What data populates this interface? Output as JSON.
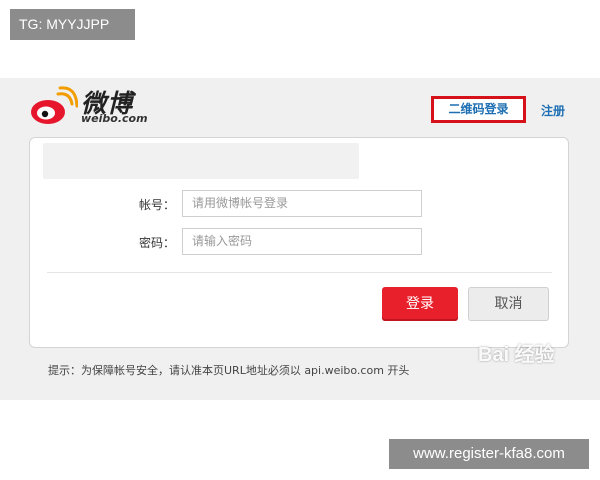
{
  "watermarks": {
    "top_left": "TG: MYYJJPP",
    "bottom_right": "www.register-kfa8.com",
    "baidu": "Bai 经验"
  },
  "header": {
    "logo_cn": "微博",
    "logo_en": "weibo.com",
    "qr_login": "二维码登录",
    "register": "注册"
  },
  "form": {
    "account_label": "帐号：",
    "account_placeholder": "请用微博帐号登录",
    "password_label": "密码：",
    "password_placeholder": "请输入密码",
    "login_button": "登录",
    "cancel_button": "取消"
  },
  "footer": {
    "tip": "提示：为保障帐号安全，请认准本页URL地址必须以 api.weibo.com 开头"
  },
  "colors": {
    "brand_red": "#e8202c",
    "link_blue": "#1e6fb3",
    "highlight_border": "#d7111a"
  }
}
